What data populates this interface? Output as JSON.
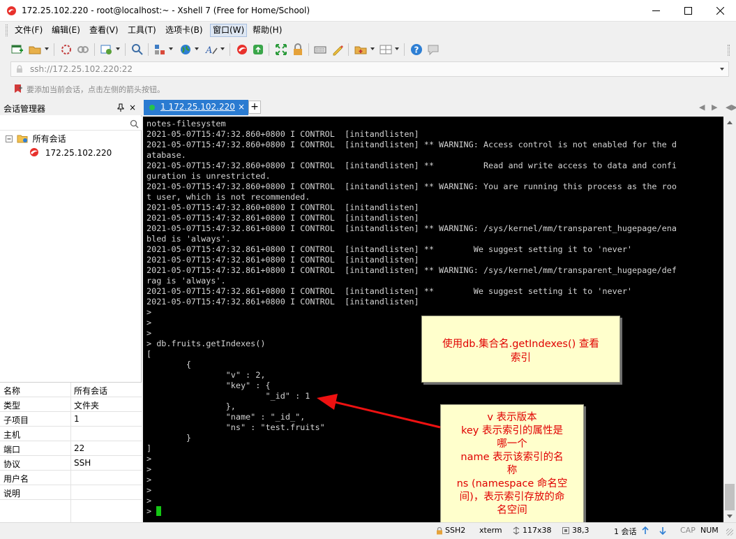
{
  "window": {
    "title": "172.25.102.220 - root@localhost:~ - Xshell 7 (Free for Home/School)"
  },
  "menu": {
    "items": [
      "文件(F)",
      "编辑(E)",
      "查看(V)",
      "工具(T)",
      "选项卡(B)",
      "窗口(W)",
      "帮助(H)"
    ],
    "active": "窗口(W)"
  },
  "address": "ssh://172.25.102.220:22",
  "hint": "要添加当前会话，点击左侧的箭头按钮。",
  "session_panel": {
    "title": "会话管理器",
    "pin": "ᵖ",
    "close": "×",
    "tree": {
      "root": "所有会话",
      "child": "172.25.102.220"
    },
    "properties": [
      {
        "key": "名称",
        "value": "所有会话"
      },
      {
        "key": "类型",
        "value": "文件夹"
      },
      {
        "key": "子项目",
        "value": "1"
      },
      {
        "key": "主机",
        "value": ""
      },
      {
        "key": "端口",
        "value": "22"
      },
      {
        "key": "协议",
        "value": "SSH"
      },
      {
        "key": "用户名",
        "value": ""
      },
      {
        "key": "说明",
        "value": ""
      }
    ]
  },
  "tab": {
    "label": "1 172.25.102.220",
    "close": "×",
    "new": "+",
    "nav_left": "◀",
    "nav_right": "▶",
    "nav_close": "◀▶"
  },
  "terminal_lines": [
    "notes-filesystem",
    "2021-05-07T15:47:32.860+0800 I CONTROL  [initandlisten]",
    "2021-05-07T15:47:32.860+0800 I CONTROL  [initandlisten] ** WARNING: Access control is not enabled for the d",
    "atabase.",
    "2021-05-07T15:47:32.860+0800 I CONTROL  [initandlisten] **          Read and write access to data and confi",
    "guration is unrestricted.",
    "2021-05-07T15:47:32.860+0800 I CONTROL  [initandlisten] ** WARNING: You are running this process as the roo",
    "t user, which is not recommended.",
    "2021-05-07T15:47:32.860+0800 I CONTROL  [initandlisten]",
    "2021-05-07T15:47:32.861+0800 I CONTROL  [initandlisten]",
    "2021-05-07T15:47:32.861+0800 I CONTROL  [initandlisten] ** WARNING: /sys/kernel/mm/transparent_hugepage/ena",
    "bled is 'always'.",
    "2021-05-07T15:47:32.861+0800 I CONTROL  [initandlisten] **        We suggest setting it to 'never'",
    "2021-05-07T15:47:32.861+0800 I CONTROL  [initandlisten]",
    "2021-05-07T15:47:32.861+0800 I CONTROL  [initandlisten] ** WARNING: /sys/kernel/mm/transparent_hugepage/def",
    "rag is 'always'.",
    "2021-05-07T15:47:32.861+0800 I CONTROL  [initandlisten] **        We suggest setting it to 'never'",
    "2021-05-07T15:47:32.861+0800 I CONTROL  [initandlisten]",
    ">",
    ">",
    ">",
    "> db.fruits.getIndexes()",
    "[",
    "        {",
    "                \"v\" : 2,",
    "                \"key\" : {",
    "                        \"_id\" : 1",
    "                },",
    "                \"name\" : \"_id_\",",
    "                \"ns\" : \"test.fruits\"",
    "        }",
    "]",
    ">",
    ">",
    ">",
    ">",
    ">",
    "> "
  ],
  "callouts": {
    "first": [
      "使用db.集合名.getIndexes()  查看",
      "索引"
    ],
    "second": [
      "v 表示版本",
      "key 表示索引的属性是",
      "哪一个",
      "name 表示该索引的名",
      "称",
      "ns (namespace 命名空",
      "间)，表示索引存放的命",
      "名空间"
    ]
  },
  "status": {
    "protocol": "SSH2",
    "term": "xterm",
    "size": "117x38",
    "pos": "38,3",
    "sessions": "1 会话",
    "caps": "CAP",
    "num": "NUM"
  },
  "colors": {
    "tab_active": "#2a7bd1",
    "callout_bg": "#ffffcc",
    "callout_text": "#e00000",
    "cursor": "#14c714"
  }
}
